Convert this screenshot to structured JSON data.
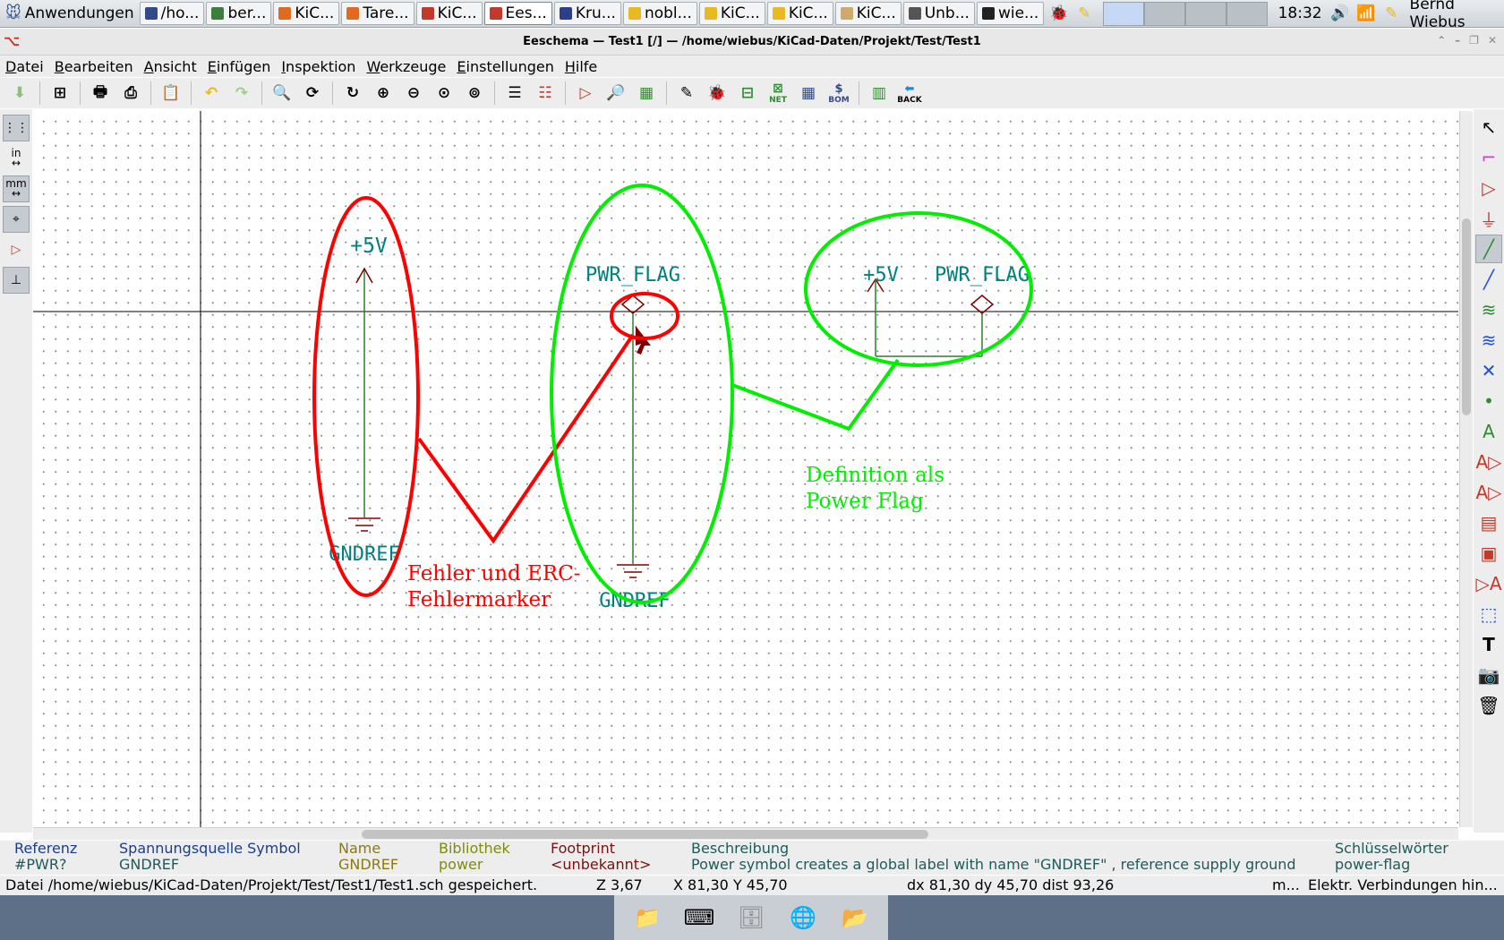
{
  "taskbar": {
    "start_label": "Anwendungen",
    "tasks": [
      {
        "label": "/ho...",
        "color": "#324a88"
      },
      {
        "label": "ber...",
        "color": "#3f7d3f"
      },
      {
        "label": "KiC...",
        "color": "#e06a20"
      },
      {
        "label": "Tare...",
        "color": "#e06a20"
      },
      {
        "label": "KiC...",
        "color": "#c0392b"
      },
      {
        "label": "Ees...",
        "color": "#c0392b"
      },
      {
        "label": "Kru...",
        "color": "#2b3f8a"
      },
      {
        "label": "nobl...",
        "color": "#e8b923"
      },
      {
        "label": "KiC...",
        "color": "#e8b923"
      },
      {
        "label": "KiC...",
        "color": "#e8b923"
      },
      {
        "label": "KiC...",
        "color": "#cfa96b"
      },
      {
        "label": "Unb...",
        "color": "#555555"
      },
      {
        "label": "wie...",
        "color": "#222222"
      }
    ],
    "clock": "18:32",
    "user": "Bernd Wiebus"
  },
  "window": {
    "title": "Eeschema — Test1 [/] — /home/wiebus/KiCad-Daten/Projekt/Test/Test1"
  },
  "menu": [
    "Datei",
    "Bearbeiten",
    "Ansicht",
    "Einfügen",
    "Inspektion",
    "Werkzeuge",
    "Einstellungen",
    "Hilfe"
  ],
  "toolbar": {
    "back_label": "BACK",
    "net_label": "NET",
    "bom_label": "BOM"
  },
  "left_toolbar": {
    "inch_label": "in",
    "mm_label": "mm"
  },
  "schematic": {
    "left_group": {
      "top_label": "+5V",
      "bottom_label": "GNDREF"
    },
    "mid_group": {
      "top_label": "PWR_FLAG",
      "bottom_label": "GNDREF"
    },
    "right_group": {
      "label_a": "+5V",
      "label_b": "PWR_FLAG"
    },
    "annotation_red": [
      "Fehler und ERC-",
      "Fehlermarker"
    ],
    "annotation_green": [
      "Definition als",
      "Power Flag"
    ],
    "colors": {
      "label": "#008080",
      "pin": "#800000",
      "wire": "#008000",
      "red": "#ff0000",
      "green": "#00ee00"
    }
  },
  "message_panel": {
    "referenz_h": "Referenz",
    "referenz_v": "#PWR?",
    "typ_h": "Spannungsquelle Symbol",
    "typ_v": "GNDREF",
    "name_h": "Name",
    "name_v": "GNDREF",
    "bib_h": "Bibliothek",
    "bib_v": "power",
    "fp_h": "Footprint",
    "fp_v": "<unbekannt>",
    "desc_h": "Beschreibung",
    "desc_v": "Power symbol creates a global label with name \"GNDREF\" , reference supply ground",
    "kw_h": "Schlüsselwörter",
    "kw_v": "power-flag"
  },
  "status": {
    "file": "Datei /home/wiebus/KiCad-Daten/Projekt/Test/Test1/Test1.sch gespeichert.",
    "zoom": "Z 3,67",
    "coords": "X 81,30  Y 45,70",
    "delta": "dx 81,30  dy 45,70  dist 93,26",
    "unit": "m...",
    "mode": "Elektr. Verbindungen hin..."
  }
}
